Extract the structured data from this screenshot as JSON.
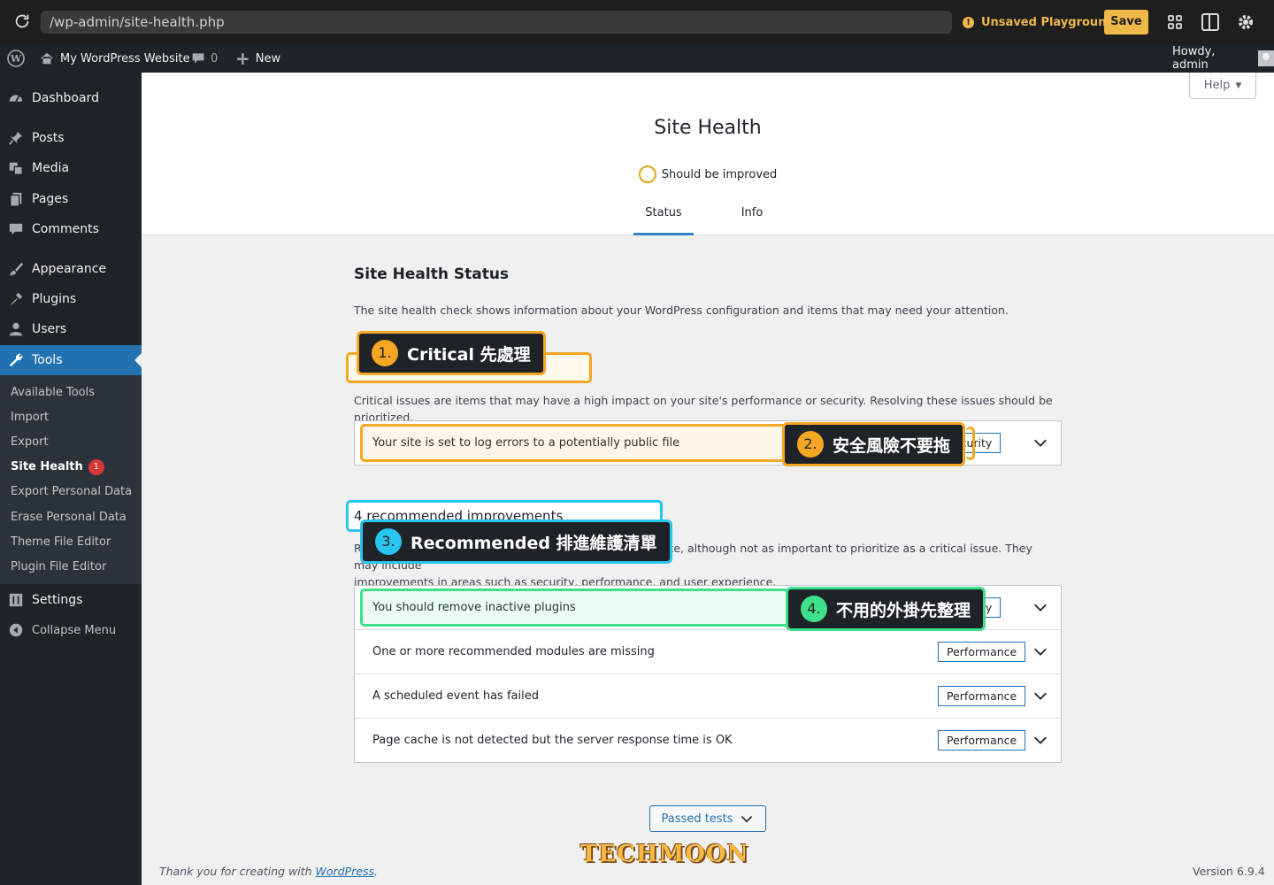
{
  "browser": {
    "url": "/wp-admin/site-health.php",
    "unsaved_label": "Unsaved Playground",
    "save_label": "Save"
  },
  "adminbar": {
    "site_name": "My WordPress Website",
    "comments_count": "0",
    "new_label": "New",
    "howdy": "Howdy, admin"
  },
  "sidebar": {
    "items": [
      {
        "label": "Dashboard",
        "icon": "dashboard-icon"
      },
      {
        "label": "Posts",
        "icon": "pin-icon"
      },
      {
        "label": "Media",
        "icon": "media-icon"
      },
      {
        "label": "Pages",
        "icon": "pages-icon"
      },
      {
        "label": "Comments",
        "icon": "comment-icon"
      },
      {
        "label": "Appearance",
        "icon": "brush-icon"
      },
      {
        "label": "Plugins",
        "icon": "plug-icon"
      },
      {
        "label": "Users",
        "icon": "user-icon"
      },
      {
        "label": "Tools",
        "icon": "wrench-icon"
      },
      {
        "label": "Settings",
        "icon": "settings-icon"
      },
      {
        "label": "Collapse Menu",
        "icon": "collapse-icon"
      }
    ],
    "submenu": [
      {
        "label": "Available Tools"
      },
      {
        "label": "Import"
      },
      {
        "label": "Export"
      },
      {
        "label": "Site Health",
        "badge": "1"
      },
      {
        "label": "Export Personal Data"
      },
      {
        "label": "Erase Personal Data"
      },
      {
        "label": "Theme File Editor"
      },
      {
        "label": "Plugin File Editor"
      }
    ]
  },
  "header": {
    "help_label": "Help",
    "title": "Site Health",
    "status": "Should be improved",
    "tabs": [
      {
        "label": "Status"
      },
      {
        "label": "Info"
      }
    ]
  },
  "main": {
    "section_title": "Site Health Status",
    "intro": "The site health check shows information about your WordPress configuration and items that may need your attention.",
    "critical_desc": "Critical issues are items that may have a high impact on your site's performance or security. Resolving these issues should be prioritized.",
    "critical_issues": [
      {
        "title": "Your site is set to log errors to a potentially public file",
        "tag": "Security"
      }
    ],
    "recommended_heading": "4 recommended improvements",
    "recommended_desc_a": "Recommended items are considered beneficial to your site, although not as important to prioritize as a critical issue. They may include",
    "recommended_desc_b": "improvements in areas such as security, performance, and user experience.",
    "recommended_issues": [
      {
        "title": "You should remove inactive plugins",
        "tag": "Security"
      },
      {
        "title": "One or more recommended modules are missing",
        "tag": "Performance"
      },
      {
        "title": "A scheduled event has failed",
        "tag": "Performance"
      },
      {
        "title": "Page cache is not detected but the server response time is OK",
        "tag": "Performance"
      }
    ],
    "passed_tests_label": "Passed tests"
  },
  "annotations": [
    {
      "num": "1.",
      "text": "Critical 先處理",
      "color": "#f5a623"
    },
    {
      "num": "2.",
      "text": "安全風險不要拖",
      "color": "#f5a623"
    },
    {
      "num": "3.",
      "text": "Recommended 排進維護清單",
      "color": "#29c4f0"
    },
    {
      "num": "4.",
      "text": "不用的外掛先整理",
      "color": "#3ee08c"
    }
  ],
  "footer": {
    "thanks_prefix": "Thank you for creating with ",
    "thanks_link": "WordPress",
    "thanks_suffix": ".",
    "version": "Version 6.9.4"
  },
  "watermark": "TECHMOON"
}
